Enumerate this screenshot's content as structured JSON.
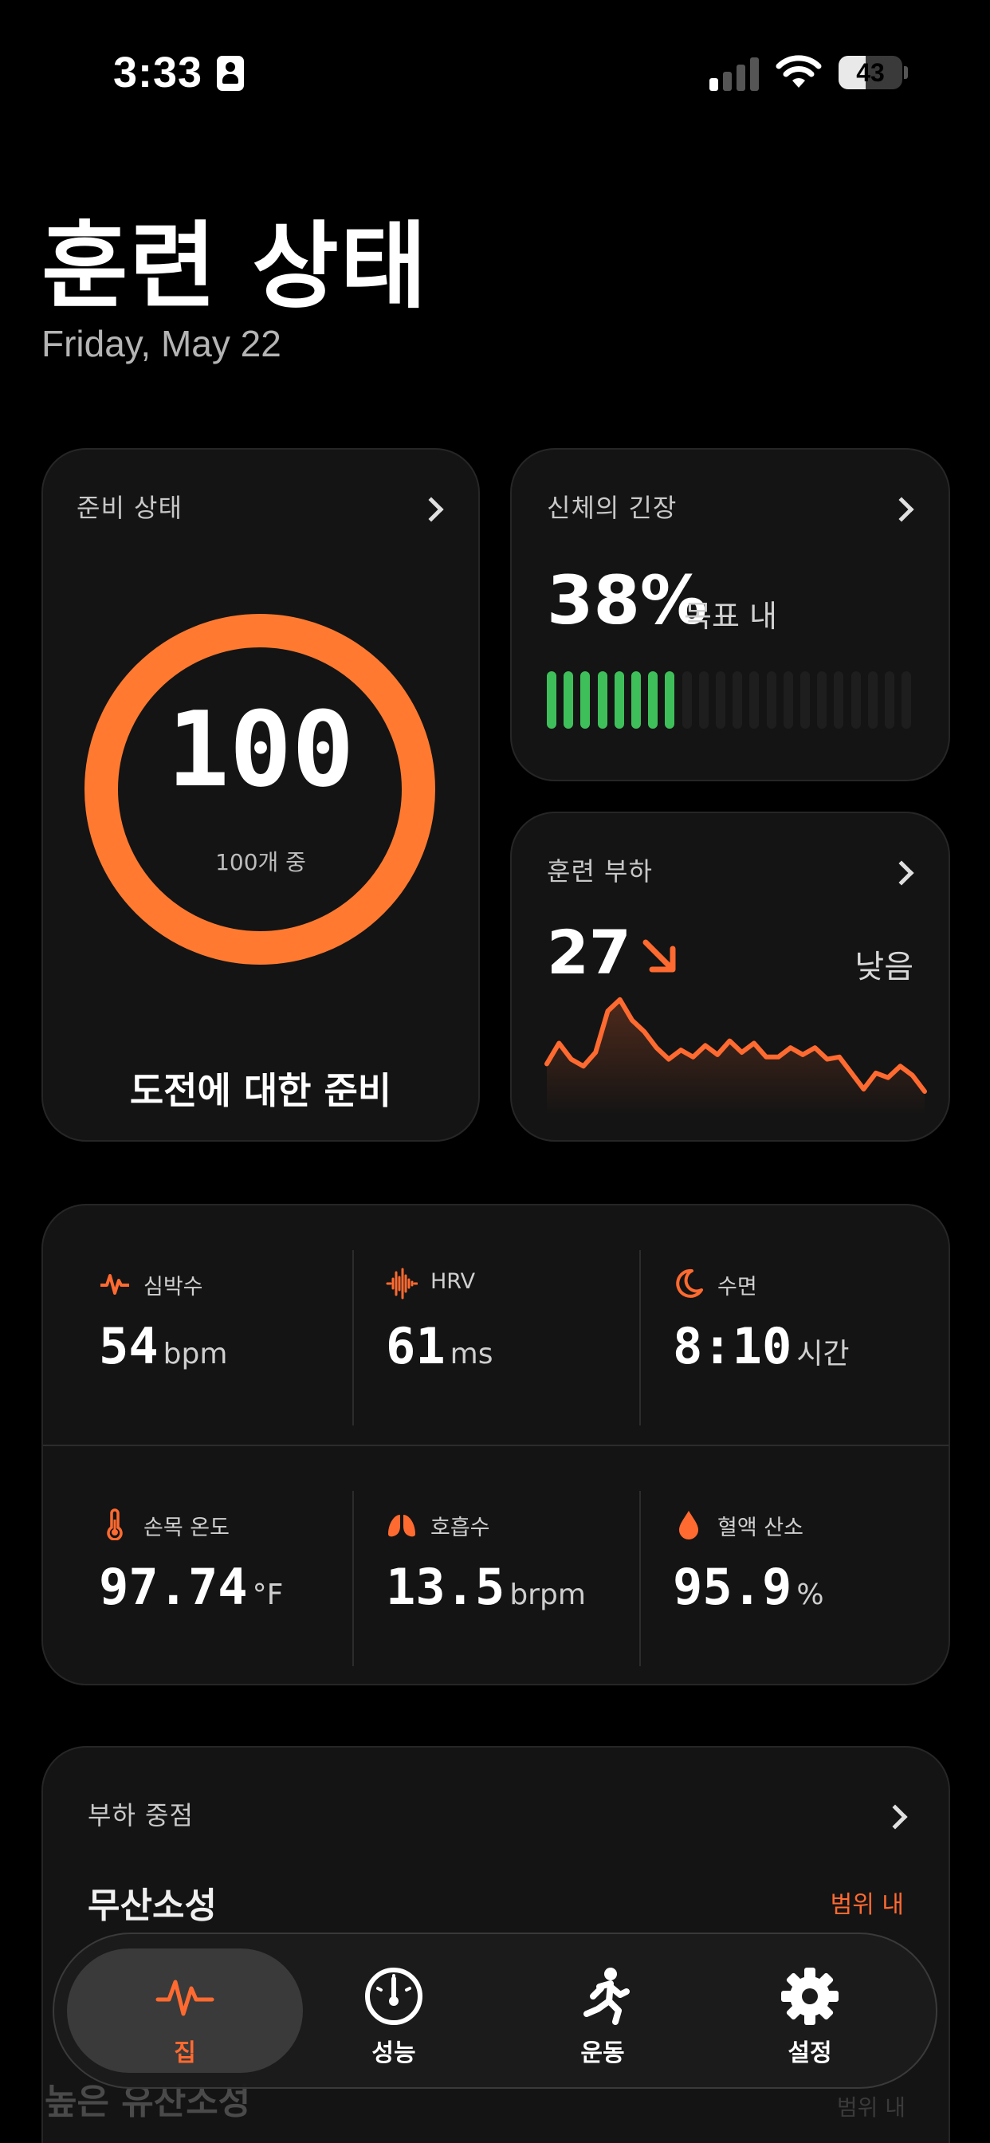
{
  "status_bar": {
    "time": "3:33",
    "battery": "43",
    "battery_level": 0.43
  },
  "header": {
    "title": "훈련 상태",
    "date": "Friday, May 22"
  },
  "readiness": {
    "label": "준비 상태",
    "value": "100",
    "sub": "100개 중",
    "caption": "도전에 대한 준비",
    "ring_color": "#ff7a30"
  },
  "strain": {
    "label": "신체의 긴장",
    "value": "38%",
    "unit": "목표 내",
    "filled_bars": 8,
    "total_bars": 22,
    "bar_color": "#3fbf5a"
  },
  "training_load": {
    "label": "훈련 부하",
    "value": "27",
    "trend": "down-right-arrow",
    "level": "낮음",
    "sparkline": [
      40,
      58,
      44,
      38,
      50,
      86,
      96,
      78,
      68,
      54,
      44,
      52,
      46,
      56,
      48,
      60,
      50,
      58,
      46,
      46,
      54,
      48,
      54,
      44,
      46,
      32,
      18,
      32,
      28,
      38,
      30,
      16
    ]
  },
  "metrics": [
    {
      "label": "심박수",
      "value": "54",
      "unit": "bpm",
      "icon": "heart-pulse-icon"
    },
    {
      "label": "HRV",
      "value": "61",
      "unit": "ms",
      "icon": "waveform-icon"
    },
    {
      "label": "수면",
      "value": "8:10",
      "unit": "시간",
      "icon": "moon-icon"
    },
    {
      "label": "손목 온도",
      "value": "97.74",
      "unit": "°F",
      "icon": "thermometer-icon"
    },
    {
      "label": "호흡수",
      "value": "13.5",
      "unit": "brpm",
      "icon": "lungs-icon"
    },
    {
      "label": "혈액 산소",
      "value": "95.9",
      "unit": "%",
      "icon": "drop-icon"
    }
  ],
  "accent_color": "#ff6a30",
  "load_focus": {
    "label": "부하 중점",
    "items": [
      {
        "name": "무산소성",
        "status": "범위 내"
      },
      {
        "name": "높은 유산소성",
        "status": "범위 내"
      }
    ]
  },
  "tabs": [
    {
      "label": "집",
      "icon": "pulse-icon",
      "active": true
    },
    {
      "label": "성능",
      "icon": "gauge-icon",
      "active": false
    },
    {
      "label": "운동",
      "icon": "runner-icon",
      "active": false
    },
    {
      "label": "설정",
      "icon": "gear-icon",
      "active": false
    }
  ]
}
